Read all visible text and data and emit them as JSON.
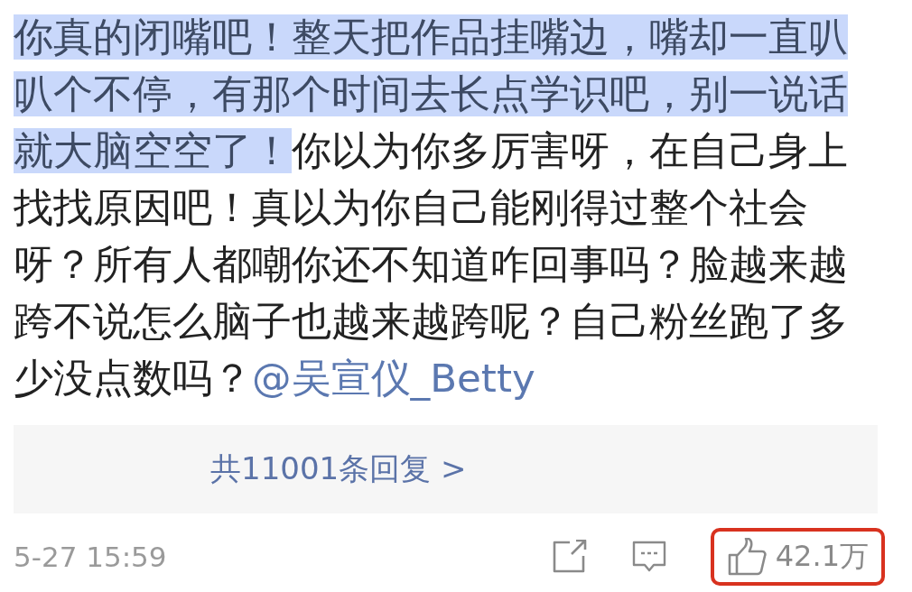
{
  "comment": {
    "segments": [
      {
        "text": "你真的闭嘴吧！整天把作品挂嘴边，嘴却一直叭叭个不停，有那个时间去长点学识吧，别一说话就大脑空空了！",
        "selected": true
      },
      {
        "text": "你以为你多厉害呀，在自己身上找找原因吧！真以为你自己能刚得过整个社会呀？所有人都嘲你还不知道咋回事吗？脸越来越跨不说怎么脑子也越来越跨呢？自己粉丝跑了多少没点数吗？",
        "selected": false
      }
    ],
    "mention": "@吴宣仪_Betty"
  },
  "replies": {
    "label": "共11001条回复 >"
  },
  "footer": {
    "time": "5-27 15:59",
    "like": {
      "count": "42.1万",
      "highlighted": true
    }
  }
}
